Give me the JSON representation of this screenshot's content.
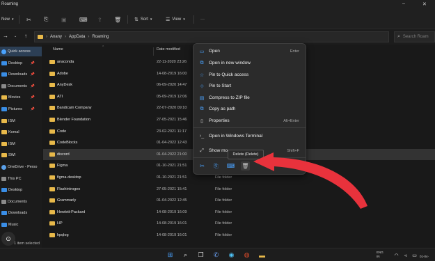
{
  "window": {
    "title": "Roaming",
    "buttons": {
      "minimize": "–",
      "close": "✕"
    }
  },
  "commandbar": {
    "new_label": "New",
    "sort_label": "Sort",
    "view_label": "View",
    "more_label": "···"
  },
  "address": {
    "crumbs": [
      "Anany",
      "AppData",
      "Roaming"
    ],
    "search_placeholder": "Search Roam"
  },
  "sidebar": {
    "items": [
      {
        "label": "Quick access",
        "kind": "star",
        "pinned": false,
        "active": true
      },
      {
        "label": "Desktop",
        "kind": "blue",
        "pinned": true
      },
      {
        "label": "Downloads",
        "kind": "blue",
        "pinned": true
      },
      {
        "label": "Documents",
        "kind": "gray",
        "pinned": true
      },
      {
        "label": "Movies",
        "kind": "folder",
        "pinned": true
      },
      {
        "label": "Pictures",
        "kind": "blue",
        "pinned": true
      },
      {
        "label": "ISM",
        "kind": "folder",
        "pinned": false
      },
      {
        "label": "Komal",
        "kind": "folder",
        "pinned": false
      },
      {
        "label": "ISM",
        "kind": "folder",
        "pinned": false
      },
      {
        "label": "SWI",
        "kind": "folder",
        "pinned": false
      },
      {
        "label": "OneDrive - Perso",
        "kind": "cloud",
        "pinned": false
      },
      {
        "label": "This PC",
        "kind": "gray",
        "pinned": false
      },
      {
        "label": "Desktop",
        "kind": "blue",
        "pinned": false
      },
      {
        "label": "Documents",
        "kind": "gray",
        "pinned": false
      },
      {
        "label": "Downloads",
        "kind": "blue",
        "pinned": false
      },
      {
        "label": "Music",
        "kind": "blue",
        "pinned": false
      }
    ],
    "pin_glyph": "📌"
  },
  "filelist": {
    "columns": {
      "name": "Name",
      "date": "Date modified"
    },
    "rows": [
      {
        "name": "anaconda",
        "date": "22-11-2020 23:26",
        "type": ""
      },
      {
        "name": "Adobe",
        "date": "14-08-2019 16:00",
        "type": ""
      },
      {
        "name": "AnyDesk",
        "date": "06-09-2020 14:47",
        "type": ""
      },
      {
        "name": "ATI",
        "date": "05-09-2019 12:06",
        "type": ""
      },
      {
        "name": "Bandicam Company",
        "date": "22-07-2020 09:10",
        "type": ""
      },
      {
        "name": "Blender Foundation",
        "date": "27-05-2021 15:46",
        "type": ""
      },
      {
        "name": "Code",
        "date": "23-02-2021 11:17",
        "type": ""
      },
      {
        "name": "CodeBlocks",
        "date": "01-04-2022 12:43",
        "type": ""
      },
      {
        "name": "discord",
        "date": "01-04-2022 21:00",
        "type": "",
        "selected": true
      },
      {
        "name": "Figma",
        "date": "01-10-2021 21:51",
        "type": ""
      },
      {
        "name": "figma-desktop",
        "date": "01-10-2021 21:51",
        "type": "File folder"
      },
      {
        "name": "Flashintrogeo",
        "date": "27-05-2021 15:41",
        "type": "File folder"
      },
      {
        "name": "Grammarly",
        "date": "01-04-2022 12:45",
        "type": "File folder"
      },
      {
        "name": "Hewlett-Packard",
        "date": "14-08-2019 16:09",
        "type": "File folder"
      },
      {
        "name": "HP",
        "date": "14-08-2019 16:01",
        "type": "File folder"
      },
      {
        "name": "hpqlog",
        "date": "14-08-2019 16:01",
        "type": "File folder"
      }
    ]
  },
  "status": {
    "text": "1 item selected"
  },
  "context_menu": {
    "items": [
      {
        "label": "Open",
        "shortcut": "Enter",
        "icon": "folder-open-icon",
        "glyph": "▭"
      },
      {
        "label": "Open in new window",
        "shortcut": "",
        "icon": "new-window-icon",
        "glyph": "⧉"
      },
      {
        "label": "Pin to Quick access",
        "shortcut": "",
        "icon": "pin-star-icon",
        "glyph": "☆"
      },
      {
        "label": "Pin to Start",
        "shortcut": "",
        "icon": "pin-icon",
        "glyph": "⊹"
      },
      {
        "label": "Compress to ZIP file",
        "shortcut": "",
        "icon": "zip-icon",
        "glyph": "▤"
      },
      {
        "label": "Copy as path",
        "shortcut": "",
        "icon": "copy-path-icon",
        "glyph": "⧉"
      },
      {
        "label": "Properties",
        "shortcut": "Alt+Enter",
        "icon": "properties-icon",
        "glyph": "▯"
      },
      {
        "label": "Open in Windows Terminal",
        "shortcut": "",
        "icon": "terminal-icon",
        "glyph": "›_"
      },
      {
        "label": "Show mo",
        "shortcut": "Shift+F",
        "icon": "show-more-icon",
        "glyph": "⤢"
      }
    ],
    "quick_actions": [
      {
        "name": "cut-icon",
        "glyph": "✂"
      },
      {
        "name": "copy-icon",
        "glyph": "⎘"
      },
      {
        "name": "rename-icon",
        "glyph": "⌨"
      },
      {
        "name": "delete-icon",
        "glyph": "🗑"
      }
    ],
    "tooltip": "Delete (Delete)"
  },
  "tray": {
    "lang": "ENG",
    "region": "IN",
    "time": "01-04-"
  },
  "colors": {
    "accent": "#4aa3ff",
    "arrow": "#e8323c",
    "folder": "#e8b94a"
  }
}
